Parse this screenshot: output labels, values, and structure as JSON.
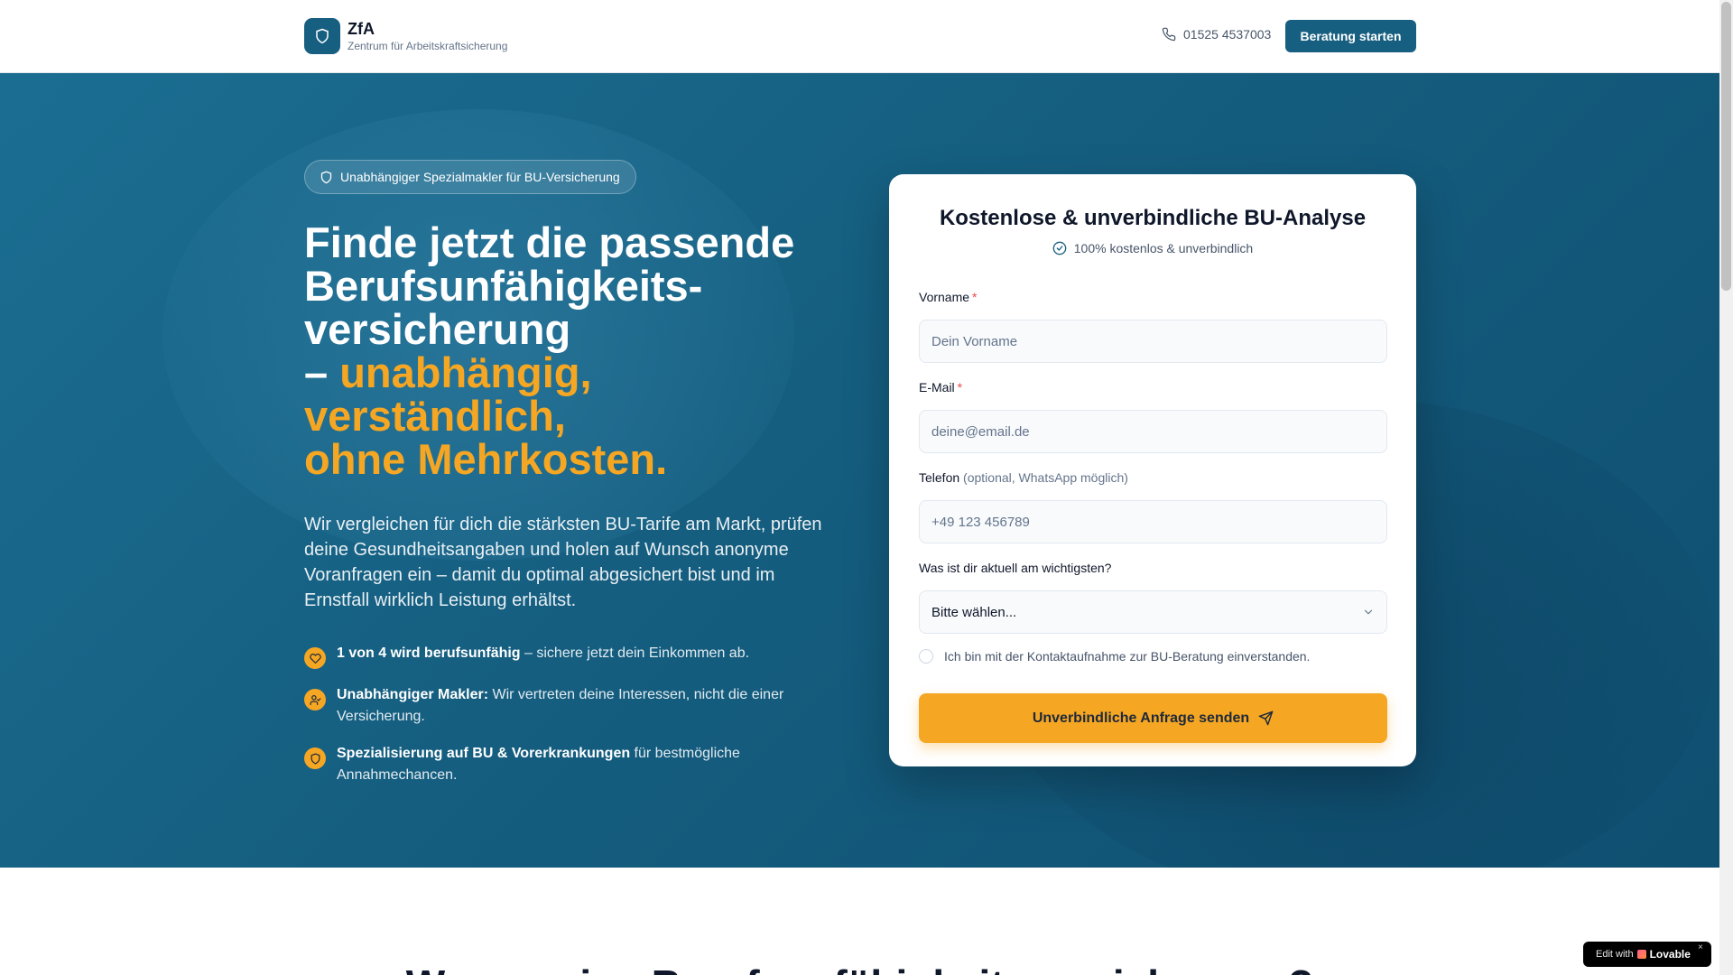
{
  "header": {
    "brand_name": "ZfA",
    "brand_sub": "Zentrum für Arbeitskraftsicherung",
    "phone": "01525 4537003",
    "cta_label": "Beratung starten"
  },
  "hero": {
    "badge": "Unabhängiger Spezialmakler für BU-Versicherung",
    "headline_lines": [
      "Finde jetzt die passende",
      "Berufsunfähigkeits-",
      "versicherung"
    ],
    "headline_dash": "– ",
    "headline_accent_lines": [
      "unabhängig,",
      "verständlich,",
      "ohne Mehrkosten."
    ],
    "lead": "Wir vergleichen für dich die stärksten BU-Tarife am Markt, prüfen deine Gesundheitsangaben und holen auf Wunsch anonyme Voranfragen ein – damit du optimal abgesichert bist und im Ernstfall wirklich Leistung erhältst.",
    "bullets": [
      {
        "icon": "heart-icon",
        "bold": "1 von 4 wird berufsunfähig",
        "text": " – sichere jetzt dein Einkommen ab."
      },
      {
        "icon": "user-check-icon",
        "bold": "Unabhängiger Makler:",
        "text": " Wir vertreten deine Interessen, nicht die einer Versicherung."
      },
      {
        "icon": "shield-icon",
        "bold": "Spezialisierung auf BU & Vorerkrankungen",
        "text": " für bestmögliche Annahmechancen."
      }
    ]
  },
  "form": {
    "title": "Kostenlose & unverbindliche BU-Analyse",
    "subtitle": "100% kostenlos & unverbindlich",
    "first_name_label": "Vorname",
    "first_name_placeholder": "Dein Vorname",
    "email_label": "E-Mail",
    "email_placeholder": "deine@email.de",
    "required_mark": "*",
    "phone_label": "Telefon",
    "phone_optional": "(optional, WhatsApp möglich)",
    "phone_placeholder": "+49 123 456789",
    "priority_label": "Was ist dir aktuell am wichtigsten?",
    "priority_selected": "Bitte wählen...",
    "consent_text": "Ich bin mit der Kontaktaufnahme zur BU-Beratung einverstanden.",
    "submit_label": "Unverbindliche Anfrage senden"
  },
  "below": {
    "title": "Warum eine Berufsunfähigkeitsversicherung?"
  },
  "badge_lovable": {
    "edit_with": "Edit with",
    "brand": "Lovable",
    "close": "×"
  },
  "colors": {
    "primary": "#175f80",
    "accent": "#f5a623",
    "required": "#ef4444"
  }
}
